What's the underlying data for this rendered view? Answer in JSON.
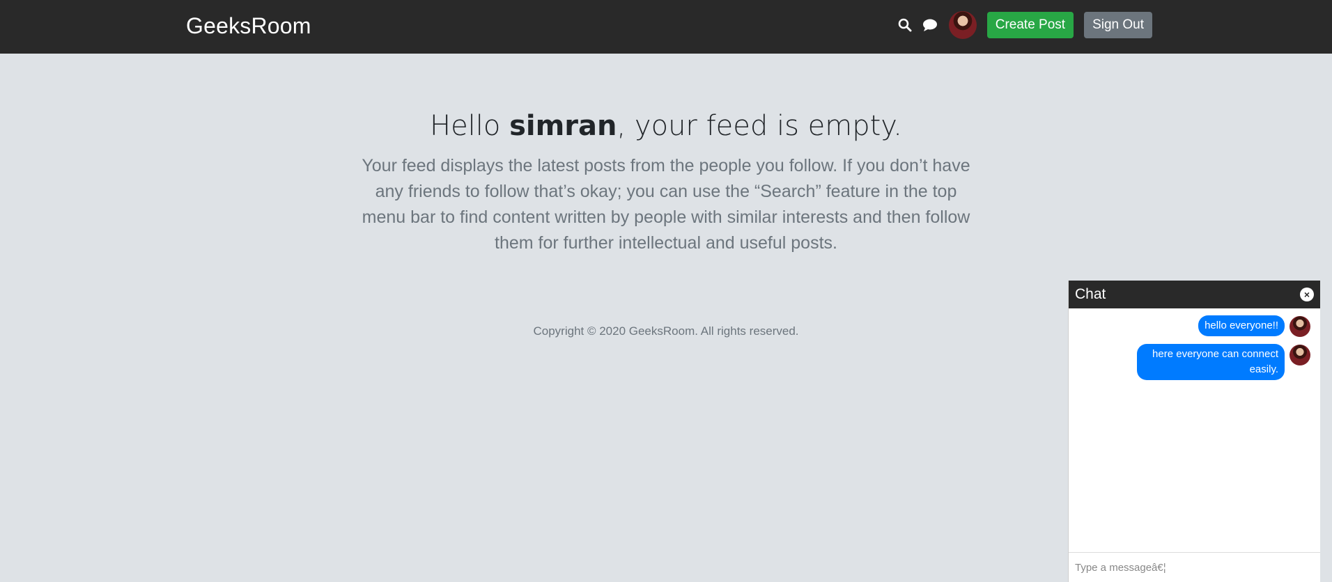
{
  "navbar": {
    "brand": "GeeksRoom",
    "icons": [
      "search-icon",
      "chat-icon"
    ],
    "create_post_label": "Create Post",
    "sign_out_label": "Sign Out"
  },
  "hero": {
    "greeting_prefix": "Hello ",
    "username": "simran",
    "greeting_suffix": ", your feed is empty.",
    "description": "Your feed displays the latest posts from the people you follow. If you don’t have any friends to follow that’s okay; you can use the “Search” feature in the top menu bar to find content written by people with similar interests and then follow them for further intellectual and useful posts."
  },
  "footer": {
    "copyright": "Copyright © 2020 GeeksRoom. All rights reserved."
  },
  "chat": {
    "title": "Chat",
    "messages": [
      {
        "text": "hello everyone!!"
      },
      {
        "text": "here everyone can connect easily."
      }
    ],
    "input_placeholder": "Type a messageâ€¦"
  },
  "colors": {
    "navbar_bg": "#292929",
    "page_bg": "#dee2e6",
    "create_button": "#28a745",
    "signout_button": "#6c757d",
    "chat_bubble": "#007bff"
  }
}
